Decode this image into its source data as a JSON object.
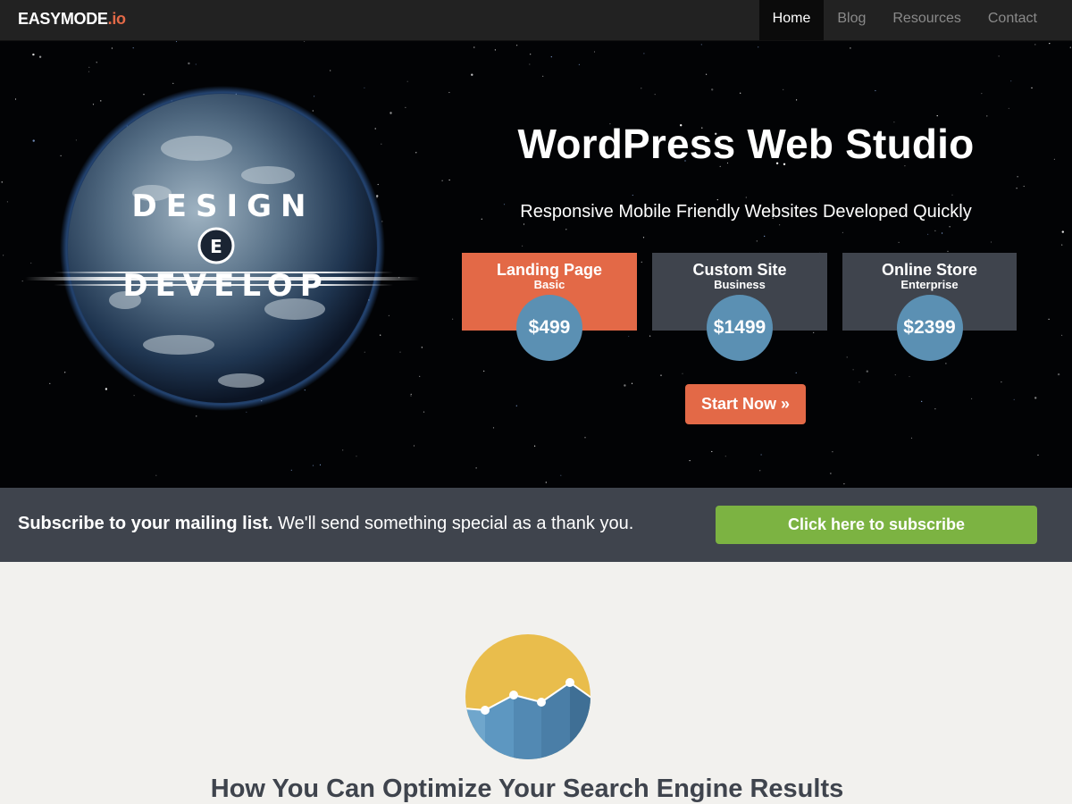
{
  "navbar": {
    "brand_main": "EASYMODE",
    "brand_tld": ".io",
    "items": [
      {
        "label": "Home",
        "active": true
      },
      {
        "label": "Blog"
      },
      {
        "label": "Resources"
      },
      {
        "label": "Contact"
      }
    ]
  },
  "hero": {
    "logo_line1": "DESIGN",
    "logo_mid": "E",
    "logo_line2": "DEVELOP",
    "title": "WordPress Web Studio",
    "subtitle": "Responsive Mobile Friendly Websites Developed Quickly",
    "plans": [
      {
        "name": "Landing Page",
        "tier": "Basic",
        "price": "$499"
      },
      {
        "name": "Custom Site",
        "tier": "Business",
        "price": "$1499"
      },
      {
        "name": "Online Store",
        "tier": "Enterprise",
        "price": "$2399"
      }
    ],
    "cta_label": "Start Now »"
  },
  "subscribe": {
    "bold_text": "Subscribe to your mailing list.",
    "text": " We'll send something special as a thank you.",
    "button_label": "Click here to subscribe"
  },
  "content": {
    "heading": "How You Can Optimize Your Search Engine Results"
  },
  "colors": {
    "accent_orange": "#e36947",
    "dark_panel": "#3f444d",
    "price_blue": "#5b90b3",
    "subscribe_green": "#7cb342"
  }
}
